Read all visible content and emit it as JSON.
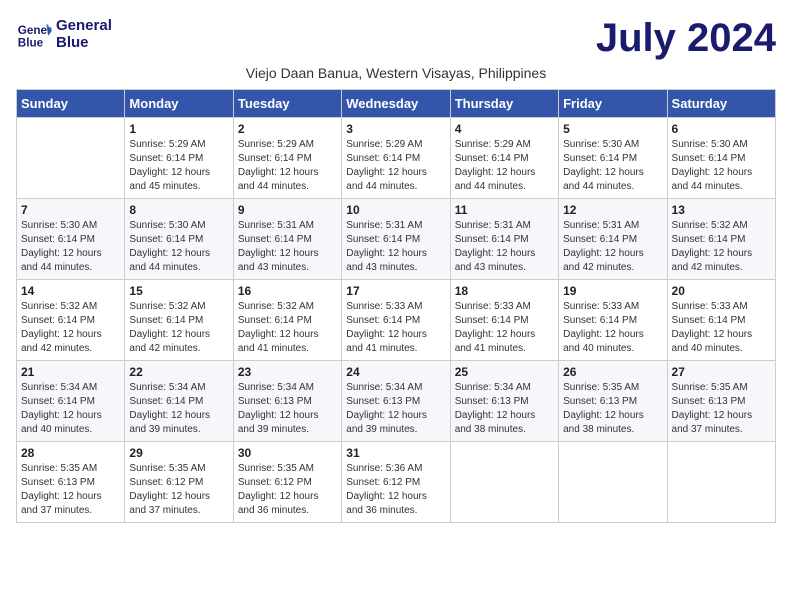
{
  "header": {
    "logo_line1": "General",
    "logo_line2": "Blue",
    "month_title": "July 2024",
    "subtitle": "Viejo Daan Banua, Western Visayas, Philippines"
  },
  "weekdays": [
    "Sunday",
    "Monday",
    "Tuesday",
    "Wednesday",
    "Thursday",
    "Friday",
    "Saturday"
  ],
  "weeks": [
    [
      {
        "day": "",
        "detail": ""
      },
      {
        "day": "1",
        "detail": "Sunrise: 5:29 AM\nSunset: 6:14 PM\nDaylight: 12 hours\nand 45 minutes."
      },
      {
        "day": "2",
        "detail": "Sunrise: 5:29 AM\nSunset: 6:14 PM\nDaylight: 12 hours\nand 44 minutes."
      },
      {
        "day": "3",
        "detail": "Sunrise: 5:29 AM\nSunset: 6:14 PM\nDaylight: 12 hours\nand 44 minutes."
      },
      {
        "day": "4",
        "detail": "Sunrise: 5:29 AM\nSunset: 6:14 PM\nDaylight: 12 hours\nand 44 minutes."
      },
      {
        "day": "5",
        "detail": "Sunrise: 5:30 AM\nSunset: 6:14 PM\nDaylight: 12 hours\nand 44 minutes."
      },
      {
        "day": "6",
        "detail": "Sunrise: 5:30 AM\nSunset: 6:14 PM\nDaylight: 12 hours\nand 44 minutes."
      }
    ],
    [
      {
        "day": "7",
        "detail": "Sunrise: 5:30 AM\nSunset: 6:14 PM\nDaylight: 12 hours\nand 44 minutes."
      },
      {
        "day": "8",
        "detail": "Sunrise: 5:30 AM\nSunset: 6:14 PM\nDaylight: 12 hours\nand 44 minutes."
      },
      {
        "day": "9",
        "detail": "Sunrise: 5:31 AM\nSunset: 6:14 PM\nDaylight: 12 hours\nand 43 minutes."
      },
      {
        "day": "10",
        "detail": "Sunrise: 5:31 AM\nSunset: 6:14 PM\nDaylight: 12 hours\nand 43 minutes."
      },
      {
        "day": "11",
        "detail": "Sunrise: 5:31 AM\nSunset: 6:14 PM\nDaylight: 12 hours\nand 43 minutes."
      },
      {
        "day": "12",
        "detail": "Sunrise: 5:31 AM\nSunset: 6:14 PM\nDaylight: 12 hours\nand 42 minutes."
      },
      {
        "day": "13",
        "detail": "Sunrise: 5:32 AM\nSunset: 6:14 PM\nDaylight: 12 hours\nand 42 minutes."
      }
    ],
    [
      {
        "day": "14",
        "detail": "Sunrise: 5:32 AM\nSunset: 6:14 PM\nDaylight: 12 hours\nand 42 minutes."
      },
      {
        "day": "15",
        "detail": "Sunrise: 5:32 AM\nSunset: 6:14 PM\nDaylight: 12 hours\nand 42 minutes."
      },
      {
        "day": "16",
        "detail": "Sunrise: 5:32 AM\nSunset: 6:14 PM\nDaylight: 12 hours\nand 41 minutes."
      },
      {
        "day": "17",
        "detail": "Sunrise: 5:33 AM\nSunset: 6:14 PM\nDaylight: 12 hours\nand 41 minutes."
      },
      {
        "day": "18",
        "detail": "Sunrise: 5:33 AM\nSunset: 6:14 PM\nDaylight: 12 hours\nand 41 minutes."
      },
      {
        "day": "19",
        "detail": "Sunrise: 5:33 AM\nSunset: 6:14 PM\nDaylight: 12 hours\nand 40 minutes."
      },
      {
        "day": "20",
        "detail": "Sunrise: 5:33 AM\nSunset: 6:14 PM\nDaylight: 12 hours\nand 40 minutes."
      }
    ],
    [
      {
        "day": "21",
        "detail": "Sunrise: 5:34 AM\nSunset: 6:14 PM\nDaylight: 12 hours\nand 40 minutes."
      },
      {
        "day": "22",
        "detail": "Sunrise: 5:34 AM\nSunset: 6:14 PM\nDaylight: 12 hours\nand 39 minutes."
      },
      {
        "day": "23",
        "detail": "Sunrise: 5:34 AM\nSunset: 6:13 PM\nDaylight: 12 hours\nand 39 minutes."
      },
      {
        "day": "24",
        "detail": "Sunrise: 5:34 AM\nSunset: 6:13 PM\nDaylight: 12 hours\nand 39 minutes."
      },
      {
        "day": "25",
        "detail": "Sunrise: 5:34 AM\nSunset: 6:13 PM\nDaylight: 12 hours\nand 38 minutes."
      },
      {
        "day": "26",
        "detail": "Sunrise: 5:35 AM\nSunset: 6:13 PM\nDaylight: 12 hours\nand 38 minutes."
      },
      {
        "day": "27",
        "detail": "Sunrise: 5:35 AM\nSunset: 6:13 PM\nDaylight: 12 hours\nand 37 minutes."
      }
    ],
    [
      {
        "day": "28",
        "detail": "Sunrise: 5:35 AM\nSunset: 6:13 PM\nDaylight: 12 hours\nand 37 minutes."
      },
      {
        "day": "29",
        "detail": "Sunrise: 5:35 AM\nSunset: 6:12 PM\nDaylight: 12 hours\nand 37 minutes."
      },
      {
        "day": "30",
        "detail": "Sunrise: 5:35 AM\nSunset: 6:12 PM\nDaylight: 12 hours\nand 36 minutes."
      },
      {
        "day": "31",
        "detail": "Sunrise: 5:36 AM\nSunset: 6:12 PM\nDaylight: 12 hours\nand 36 minutes."
      },
      {
        "day": "",
        "detail": ""
      },
      {
        "day": "",
        "detail": ""
      },
      {
        "day": "",
        "detail": ""
      }
    ]
  ]
}
